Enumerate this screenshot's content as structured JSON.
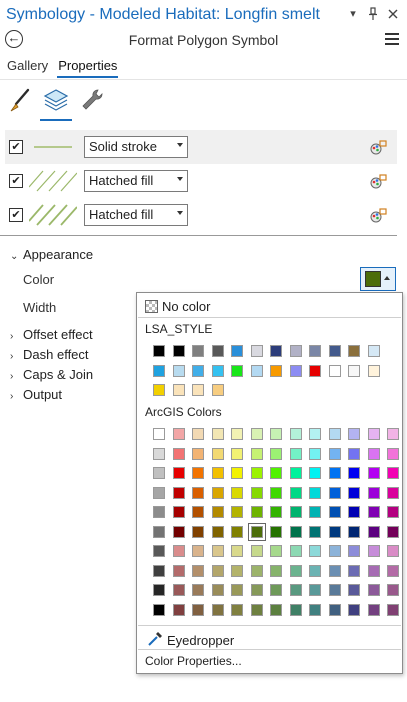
{
  "window": {
    "title": "Symbology - Modeled Habitat: Longfin smelt",
    "icons": [
      "dropdown-icon",
      "pin-icon",
      "close-icon"
    ]
  },
  "header": {
    "back_icon": "back-arrow-icon",
    "title": "Format Polygon Symbol",
    "menu_icon": "hamburger-menu-icon"
  },
  "tabs": [
    {
      "label": "Gallery",
      "active": false
    },
    {
      "label": "Properties",
      "active": true
    }
  ],
  "subtabs": [
    {
      "icon": "paintbrush-icon",
      "active": false
    },
    {
      "icon": "layers-icon",
      "active": true
    },
    {
      "icon": "wrench-icon",
      "active": false
    }
  ],
  "layers": [
    {
      "checked": true,
      "type": "Solid stroke",
      "swatch": "stroke"
    },
    {
      "checked": true,
      "type": "Hatched fill",
      "swatch": "hatch-thin"
    },
    {
      "checked": true,
      "type": "Hatched fill",
      "swatch": "hatch-thick"
    }
  ],
  "appearance": {
    "label": "Appearance",
    "color_label": "Color",
    "width_label": "Width",
    "current_color": "#4c6d0a"
  },
  "sections": [
    "Offset effect",
    "Dash effect",
    "Caps & Join",
    "Output"
  ],
  "color_picker": {
    "no_color": "No color",
    "lsa_label": "LSA_STYLE",
    "lsa_colors": [
      [
        "#000000",
        "#000000",
        "#7f7f7f",
        "#595959",
        "#2a8fd9",
        "#d9d9e0",
        "#2c3d7a",
        "#b1b1c6",
        "#7a86a6",
        "#435a8c",
        "#8a6f3c",
        "#d5e8f5"
      ],
      [
        "#1fa2e0",
        "#b8dbef",
        "#41aee8",
        "#35c1f0",
        "#19e619",
        "#b3d9f2",
        "#f79a00",
        "#8c8cf2",
        "#e60000",
        "#ffffff",
        "#f7f7f7",
        "#fff3dc"
      ],
      [
        "#f2d000",
        "#fae3ba",
        "#fae3ba",
        "#f7cd80"
      ]
    ],
    "arcgis_label": "ArcGIS Colors",
    "arcgis_colors": [
      [
        "#ffffff",
        "#f2a6a6",
        "#f2d9b3",
        "#f2e6b3",
        "#f2f2b3",
        "#d9f2b3",
        "#c6f2b3",
        "#b3f2d9",
        "#b3f2f2",
        "#b3d9f2",
        "#b3b3f2",
        "#e6b3f2",
        "#f2b3e6"
      ],
      [
        "#d9d9d9",
        "#f27373",
        "#f2b373",
        "#f2d973",
        "#f2f273",
        "#c6f273",
        "#9cf273",
        "#73f2c6",
        "#73f2f2",
        "#73b3f2",
        "#7373f2",
        "#d973f2",
        "#f273d9"
      ],
      [
        "#c0c0c0",
        "#e60000",
        "#f27300",
        "#f2c000",
        "#f2f200",
        "#9cf200",
        "#52f200",
        "#00f29c",
        "#00f2f2",
        "#0073f2",
        "#0000f2",
        "#b300f2",
        "#f200b3"
      ],
      [
        "#a6a6a6",
        "#c00000",
        "#d95f00",
        "#d9a600",
        "#d9d900",
        "#86d900",
        "#40d900",
        "#00d986",
        "#00d9d9",
        "#0060d9",
        "#0000d9",
        "#9c00d9",
        "#d9009c"
      ],
      [
        "#8c8c8c",
        "#a60000",
        "#b35000",
        "#b38a00",
        "#b3b300",
        "#6eb300",
        "#33b300",
        "#00b36e",
        "#00b3b3",
        "#0050b3",
        "#0000b3",
        "#8000b3",
        "#b30080"
      ],
      [
        "#737373",
        "#730000",
        "#804000",
        "#806300",
        "#808000",
        "#4c6d0a",
        "#267300",
        "#00734c",
        "#007373",
        "#003a80",
        "#002673",
        "#5c0080",
        "#730059"
      ],
      [
        "#595959",
        "#d98c8c",
        "#d9b38c",
        "#d9c68c",
        "#d9d98c",
        "#c6d98c",
        "#a6d98c",
        "#8cd9b3",
        "#8cd9d9",
        "#8cb3d9",
        "#8c8cd9",
        "#c68cd9",
        "#d98cc6"
      ],
      [
        "#404040",
        "#b36b6b",
        "#b38f6b",
        "#b3a66b",
        "#b3b36b",
        "#9cb36b",
        "#86b36b",
        "#6bb38f",
        "#6bb3b3",
        "#6b8fb3",
        "#6b6bb3",
        "#a66bb3",
        "#b36ba6"
      ],
      [
        "#262626",
        "#995959",
        "#997a59",
        "#998c59",
        "#999959",
        "#869959",
        "#6e9959",
        "#599980",
        "#599999",
        "#597a99",
        "#595999",
        "#8c5999",
        "#99598c"
      ],
      [
        "#000000",
        "#804040",
        "#806040",
        "#807340",
        "#808040",
        "#6e8040",
        "#5c8040",
        "#408066",
        "#408080",
        "#406080",
        "#404080",
        "#734080",
        "#804073"
      ]
    ],
    "selected_arcgis": [
      5,
      5
    ],
    "eyedropper": "Eyedropper",
    "eyedropper_icon": "eyedropper-icon",
    "color_properties": "Color Properties..."
  }
}
